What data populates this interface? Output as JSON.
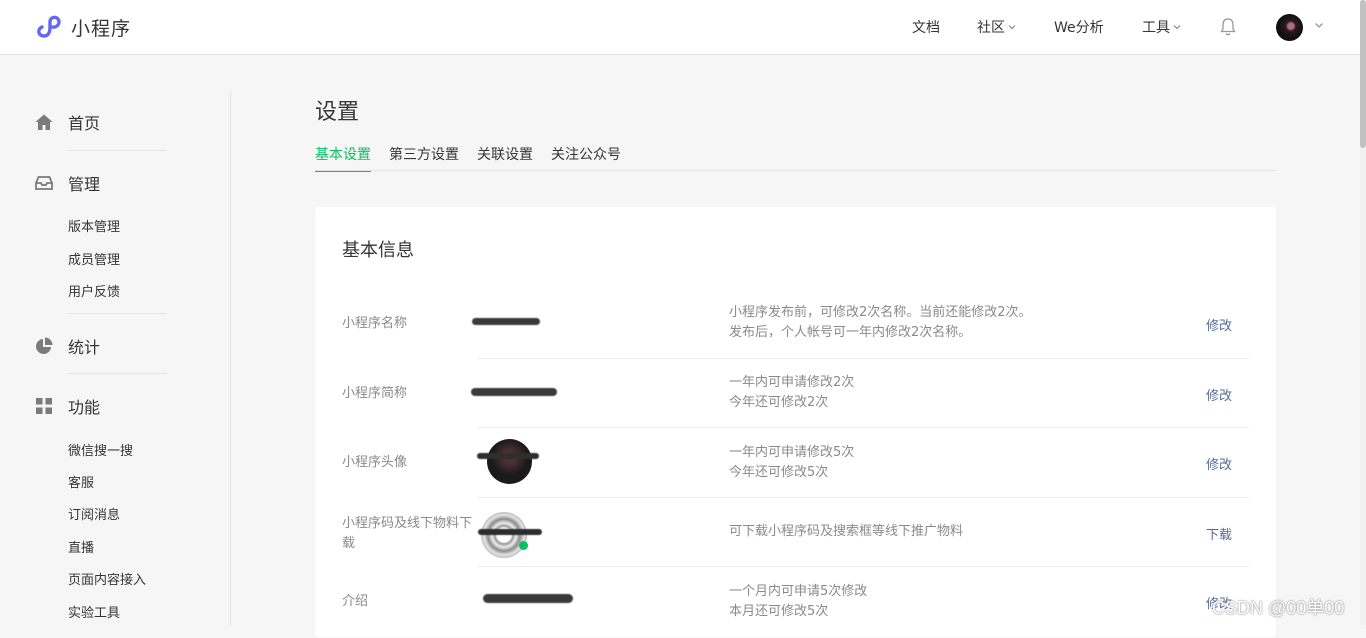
{
  "app": {
    "title": "小程序"
  },
  "topnav": {
    "items": [
      {
        "label": "文档",
        "has_dropdown": false
      },
      {
        "label": "社区",
        "has_dropdown": true
      },
      {
        "label": "We分析",
        "has_dropdown": false
      },
      {
        "label": "工具",
        "has_dropdown": true
      }
    ],
    "bell_icon": "bell-icon",
    "avatar_icon": "user-avatar"
  },
  "sidebar": {
    "sections": [
      {
        "icon": "home-icon",
        "label": "首页",
        "items": []
      },
      {
        "icon": "inbox-icon",
        "label": "管理",
        "items": [
          "版本管理",
          "成员管理",
          "用户反馈"
        ]
      },
      {
        "icon": "pie-chart-icon",
        "label": "统计",
        "items": []
      },
      {
        "icon": "grid-icon",
        "label": "功能",
        "items": [
          "微信搜一搜",
          "客服",
          "订阅消息",
          "直播",
          "页面内容接入",
          "实验工具"
        ]
      }
    ]
  },
  "main": {
    "title": "设置",
    "tabs": [
      {
        "label": "基本设置",
        "active": true
      },
      {
        "label": "第三方设置",
        "active": false
      },
      {
        "label": "关联设置",
        "active": false
      },
      {
        "label": "关注公众号",
        "active": false
      }
    ],
    "card": {
      "title": "基本信息",
      "rows": [
        {
          "label": "小程序名称",
          "desc": [
            "小程序发布前，可修改2次名称。当前还能修改2次。",
            "发布后，个人帐号可一年内修改2次名称。"
          ],
          "action": "修改"
        },
        {
          "label": "小程序简称",
          "desc": [
            "一年内可申请修改2次",
            "今年还可修改2次"
          ],
          "action": "修改"
        },
        {
          "label": "小程序头像",
          "desc": [
            "一年内可申请修改5次",
            "今年还可修改5次"
          ],
          "action": "修改"
        },
        {
          "label": "小程序码及线下物料下载",
          "desc": [
            "可下载小程序码及搜索框等线下推广物料"
          ],
          "action": "下载"
        },
        {
          "label": "介绍",
          "desc": [
            "一个月内可申请5次修改",
            "本月还可修改5次"
          ],
          "action": "修改"
        }
      ]
    }
  },
  "watermark": "CSDN @00单00",
  "colors": {
    "accent": "#07c160",
    "link": "#576b95",
    "muted": "#8a8a8a"
  }
}
